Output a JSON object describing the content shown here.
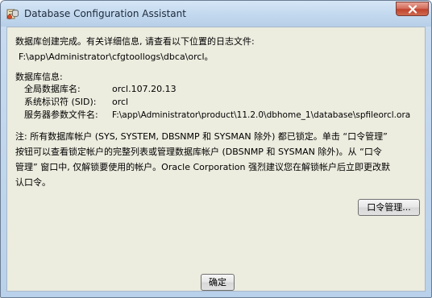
{
  "window": {
    "title": "Database Configuration Assistant",
    "app_icon": "database-config-icon",
    "close_icon": "close-icon"
  },
  "message": {
    "line1": "数据库创建完成。有关详细信息, 请查看以下位置的日志文件:",
    "log_path": "F:\\app\\Administrator\\cfgtoollogs\\dbca\\orcl。",
    "info_header": "数据库信息:",
    "fields": [
      {
        "label": "全局数据库名:",
        "value": "orcl.107.20.13"
      },
      {
        "label": "系统标识符 (SID):",
        "value": "orcl"
      },
      {
        "label": "服务器参数文件名:",
        "value": "F:\\app\\Administrator\\product\\11.2.0\\dbhome_1\\database\\spfileorcl.ora"
      }
    ],
    "note_lines": [
      "注: 所有数据库帐户 (SYS, SYSTEM, DBSNMP 和 SYSMAN 除外) 都已锁定。单击 “口令管理”",
      "按钮可以查看锁定帐户的完整列表或管理数据库帐户 (DBSNMP 和 SYSMAN 除外)。从 “口令",
      "管理” 窗口中, 仅解锁要使用的帐户。Oracle Corporation 强烈建议您在解锁帐户后立即更改默",
      "认口令。"
    ]
  },
  "buttons": {
    "password_mgmt": "口令管理...",
    "ok": "确定"
  }
}
